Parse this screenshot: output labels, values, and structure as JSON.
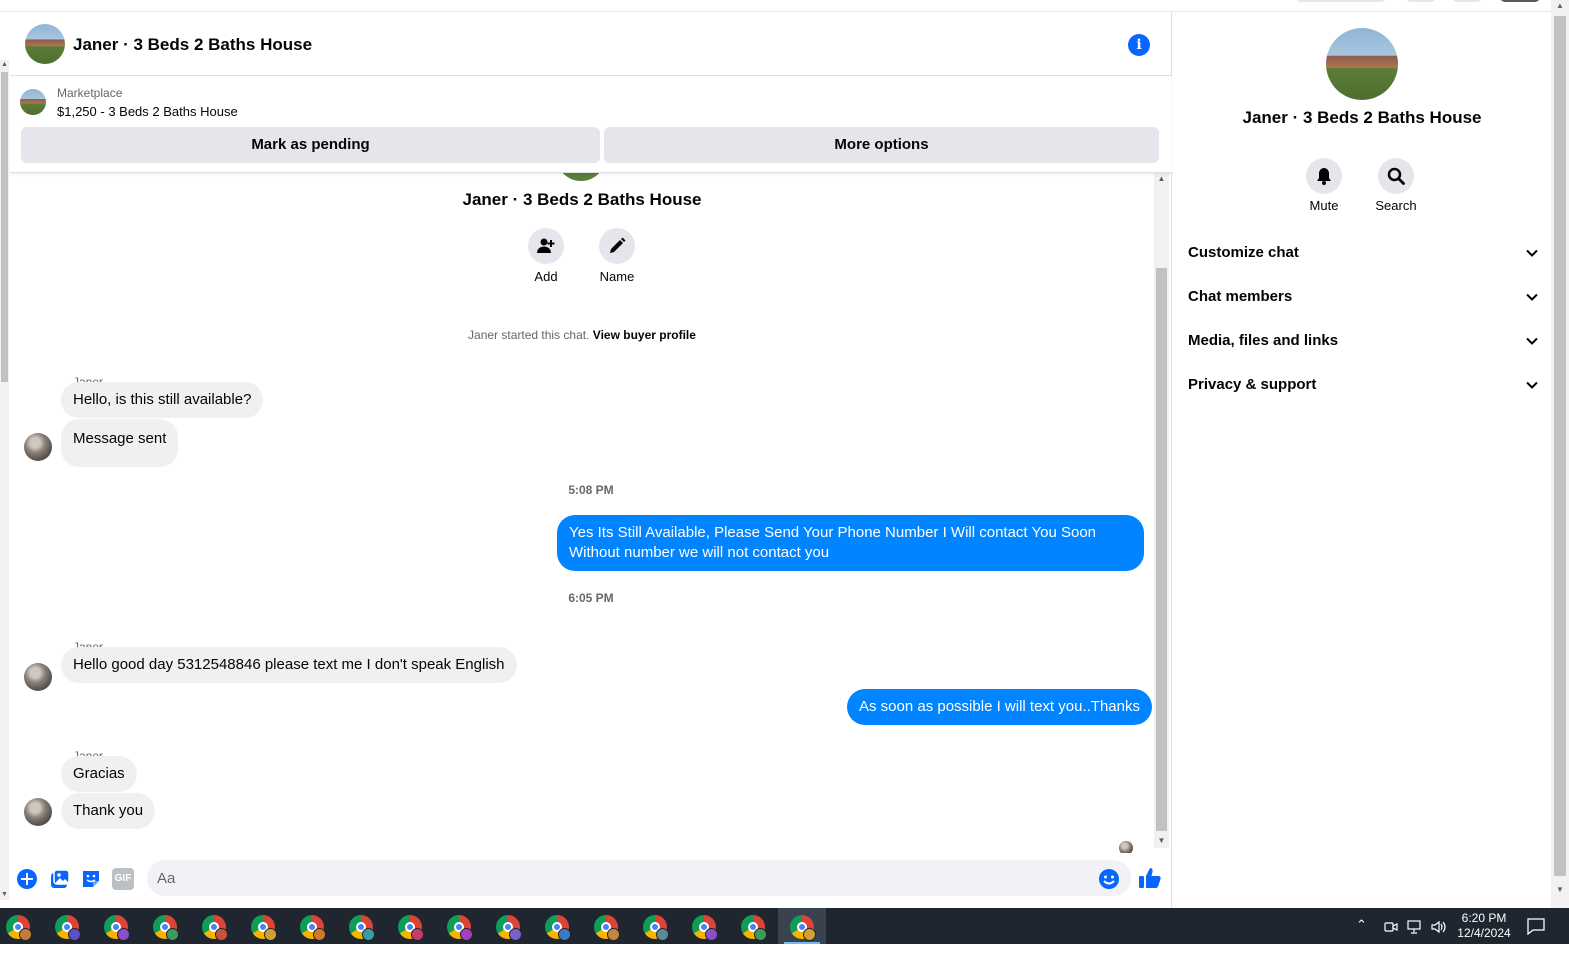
{
  "header": {
    "title": "Janer · 3 Beds 2 Baths House",
    "info_icon": "info-icon"
  },
  "marketplace": {
    "label": "Marketplace",
    "item": "$1,250 - 3 Beds 2 Baths House",
    "mark_pending": "Mark as pending",
    "more_options": "More options"
  },
  "conversation": {
    "name": "Janer · 3 Beds 2 Baths House",
    "add_label": "Add",
    "name_label": "Name",
    "started_text": "Janer started this chat.",
    "view_profile": "View buyer profile"
  },
  "messages": {
    "sender1": "Janer",
    "m1": "Hello, is this still available?",
    "m2": "Message sent",
    "time1": "5:08 PM",
    "out1_line1": "Yes Its Still Available, Please Send Your Phone Number I Will contact  You Soon",
    "out1_line2": "Without number we will not contact you",
    "time2": "6:05 PM",
    "sender2": "Janer",
    "m3": "Hello good day 5312548846 please text me I don't speak English",
    "out2": "As soon as possible I will text you..Thanks",
    "sender3": "Janer",
    "m4": "Gracias",
    "m5": "Thank you"
  },
  "composer": {
    "placeholder": "Aa",
    "gif_label": "GIF"
  },
  "right_panel": {
    "title": "Janer · 3 Beds 2 Baths House",
    "mute": "Mute",
    "search": "Search",
    "sections": [
      "Customize chat",
      "Chat members",
      "Media, files and links",
      "Privacy & support"
    ]
  },
  "taskbar": {
    "time": "6:20 PM",
    "date": "12/4/2024"
  },
  "colors": {
    "accent": "#0084ff",
    "info_blue": "#0866ff",
    "bubble_in": "#f0f0f0",
    "button_gray": "#e4e6eb",
    "taskbar": "#1f2630"
  }
}
